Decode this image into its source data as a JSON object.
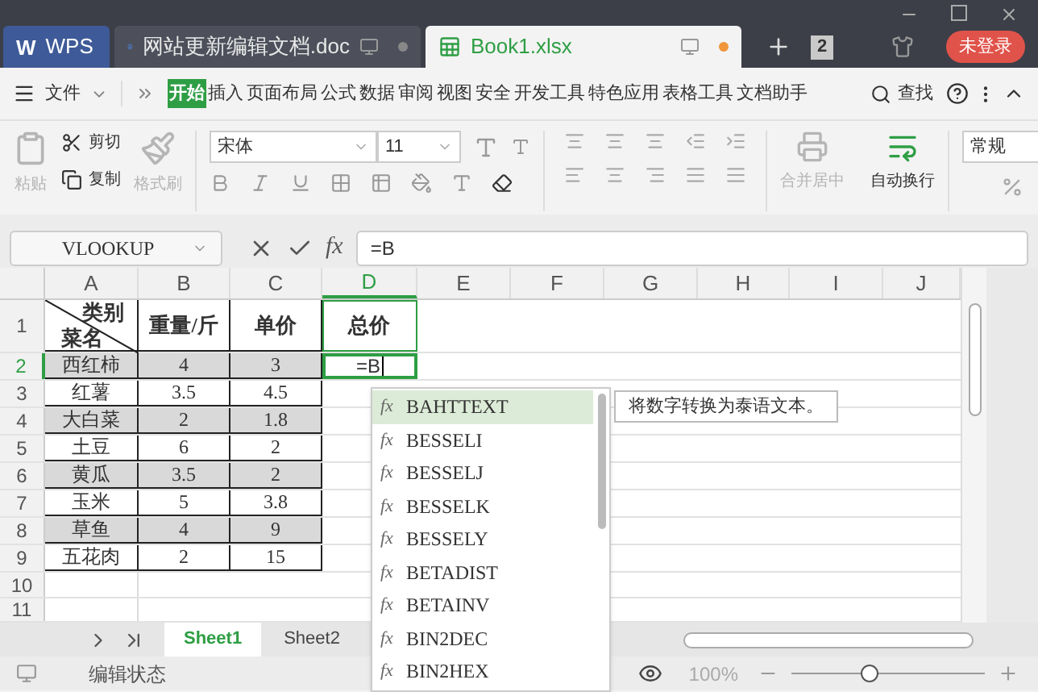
{
  "title_tabs": [
    {
      "label": "WPS",
      "kind": "home",
      "logo": "W",
      "selected": false
    },
    {
      "label": "网站更新编辑文档.doc",
      "kind": "doc",
      "selected": false
    },
    {
      "label": "Book1.xlsx",
      "kind": "sheet",
      "selected": true
    }
  ],
  "window_count": "2",
  "login_button": "未登录",
  "menu": {
    "file": "文件",
    "ribbon_tabs": [
      {
        "label": "开始",
        "selected": true
      },
      {
        "label": "插入",
        "selected": false
      },
      {
        "label": "页面布局",
        "selected": false
      },
      {
        "label": "公式",
        "selected": false
      },
      {
        "label": "数据",
        "selected": false
      },
      {
        "label": "审阅",
        "selected": false
      },
      {
        "label": "视图",
        "selected": false
      },
      {
        "label": "安全",
        "selected": false
      },
      {
        "label": "开发工具",
        "selected": false
      },
      {
        "label": "特色应用",
        "selected": false
      },
      {
        "label": "表格工具",
        "selected": false
      },
      {
        "label": "文档助手",
        "selected": false
      }
    ],
    "search": "查找"
  },
  "toolbar": {
    "paste": {
      "label": "粘贴",
      "disabled": true
    },
    "cut": {
      "label": "剪切",
      "disabled": false
    },
    "copy": {
      "label": "复制",
      "disabled": false
    },
    "format_painter": {
      "label": "格式刷",
      "disabled": true
    },
    "font": "宋体",
    "font_size": "11",
    "merge": {
      "label": "合并居中",
      "disabled": true
    },
    "wrap": {
      "label": "自动换行",
      "disabled": false
    },
    "number_format": "常规"
  },
  "formula_bar": {
    "name_box": "VLOOKUP",
    "function_symbol": "fx",
    "formula": "=B"
  },
  "columns": [
    {
      "label": "A",
      "selected": false
    },
    {
      "label": "B",
      "selected": false
    },
    {
      "label": "C",
      "selected": false
    },
    {
      "label": "D",
      "selected": true
    },
    {
      "label": "E",
      "selected": false
    },
    {
      "label": "F",
      "selected": false
    },
    {
      "label": "G",
      "selected": false
    },
    {
      "label": "H",
      "selected": false
    },
    {
      "label": "I",
      "selected": false
    },
    {
      "label": "J",
      "selected": false
    }
  ],
  "rows": [
    {
      "number": "1",
      "kind": "header",
      "selected": false,
      "shaded": false,
      "diagonal_top": "类别",
      "diagonal_bottom": "菜名",
      "cells": [
        "重量/斤",
        "单价",
        "总价"
      ]
    },
    {
      "number": "2",
      "kind": "data",
      "selected": true,
      "shaded": true,
      "cells": [
        "西红柿",
        "4",
        "3",
        "=B"
      ]
    },
    {
      "number": "3",
      "kind": "data",
      "selected": false,
      "shaded": false,
      "cells": [
        "红薯",
        "3.5",
        "4.5"
      ]
    },
    {
      "number": "4",
      "kind": "data",
      "selected": false,
      "shaded": true,
      "cells": [
        "大白菜",
        "2",
        "1.8"
      ]
    },
    {
      "number": "5",
      "kind": "data",
      "selected": false,
      "shaded": false,
      "cells": [
        "土豆",
        "6",
        "2"
      ]
    },
    {
      "number": "6",
      "kind": "data",
      "selected": false,
      "shaded": true,
      "cells": [
        "黄瓜",
        "3.5",
        "2"
      ]
    },
    {
      "number": "7",
      "kind": "data",
      "selected": false,
      "shaded": false,
      "cells": [
        "玉米",
        "5",
        "3.8"
      ]
    },
    {
      "number": "8",
      "kind": "data",
      "selected": false,
      "shaded": true,
      "cells": [
        "草鱼",
        "4",
        "9"
      ]
    },
    {
      "number": "9",
      "kind": "data",
      "selected": false,
      "shaded": false,
      "cells": [
        "五花肉",
        "2",
        "15"
      ]
    },
    {
      "number": "10",
      "kind": "empty",
      "selected": false,
      "shaded": false,
      "cells": []
    },
    {
      "number": "11",
      "kind": "empty",
      "selected": false,
      "shaded": false,
      "cells": []
    }
  ],
  "autocomplete": {
    "items": [
      {
        "icon": "fx",
        "label": "BAHTTEXT",
        "selected": true
      },
      {
        "icon": "fx",
        "label": "BESSELI",
        "selected": false
      },
      {
        "icon": "fx",
        "label": "BESSELJ",
        "selected": false
      },
      {
        "icon": "fx",
        "label": "BESSELK",
        "selected": false
      },
      {
        "icon": "fx",
        "label": "BESSELY",
        "selected": false
      },
      {
        "icon": "fx",
        "label": "BETADIST",
        "selected": false
      },
      {
        "icon": "fx",
        "label": "BETAINV",
        "selected": false
      },
      {
        "icon": "fx",
        "label": "BIN2DEC",
        "selected": false
      },
      {
        "icon": "fx",
        "label": "BIN2HEX",
        "selected": false
      }
    ],
    "tooltip": "将数字转换为泰语文本。"
  },
  "sheet_tabs": [
    {
      "label": "Sheet1",
      "selected": true
    },
    {
      "label": "Sheet2",
      "selected": false
    }
  ],
  "status_bar": {
    "mode": "编辑状态",
    "zoom": "100%",
    "zoom_slider": {
      "level": 0.4
    }
  }
}
